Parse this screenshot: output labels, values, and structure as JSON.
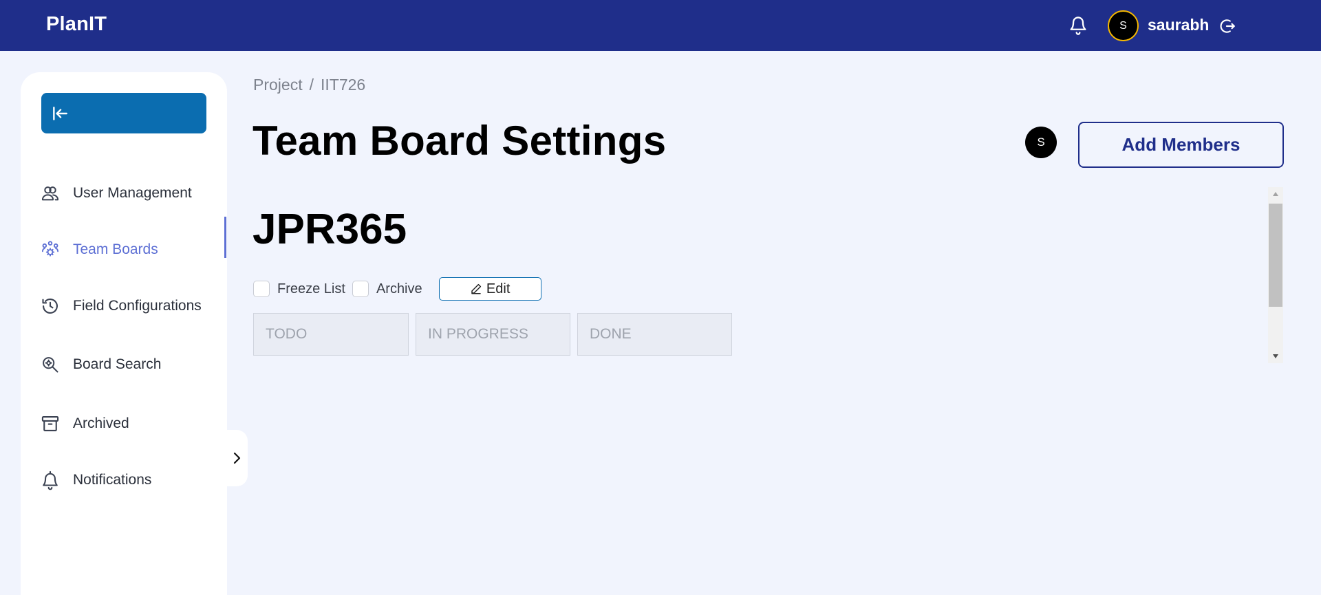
{
  "header": {
    "brand": "PlanIT",
    "avatar_initial": "S",
    "username": "saurabh"
  },
  "sidebar": {
    "items": [
      {
        "label": "User Management",
        "icon": "users-icon"
      },
      {
        "label": "Team Boards",
        "icon": "team-gear-icon",
        "active": true
      },
      {
        "label": "Field Configurations",
        "icon": "history-icon"
      },
      {
        "label": "Board Search",
        "icon": "search-gear-icon"
      },
      {
        "label": "Archived",
        "icon": "archive-icon"
      },
      {
        "label": "Notifications",
        "icon": "bell-icon"
      }
    ]
  },
  "breadcrumb": {
    "root": "Project",
    "separator": "/",
    "current": "IIT726"
  },
  "page": {
    "title": "Team Board Settings",
    "member_initial": "S",
    "add_members_label": "Add Members"
  },
  "board": {
    "name": "JPR365",
    "freeze_label": "Freeze List",
    "archive_label": "Archive",
    "edit_label": "Edit",
    "lists": [
      "TODO",
      "IN PROGRESS",
      "DONE"
    ]
  },
  "colors": {
    "header_bg": "#1f2e8a",
    "accent_blue": "#0b6db0",
    "active_nav": "#5d6fd4",
    "page_bg": "#f1f4fd"
  }
}
